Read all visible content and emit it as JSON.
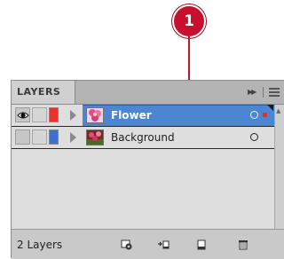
{
  "callout": {
    "number": "1"
  },
  "panel": {
    "tab_label": "LAYERS",
    "layers": [
      {
        "name": "Flower",
        "selected": true,
        "visible": true,
        "color": "#e8322c",
        "thumbnail": "flower-thumbnail"
      },
      {
        "name": "Background",
        "selected": false,
        "visible": false,
        "color": "#3f6fd1",
        "thumbnail": "background-thumbnail"
      }
    ],
    "layer_count": "2 Layers",
    "bottom_icons": [
      "make-clipping-mask-icon",
      "create-sublayer-icon",
      "create-new-layer-icon",
      "delete-layer-icon"
    ]
  },
  "colors": {
    "selection": "#4a86d2",
    "callout": "#c8102e"
  }
}
